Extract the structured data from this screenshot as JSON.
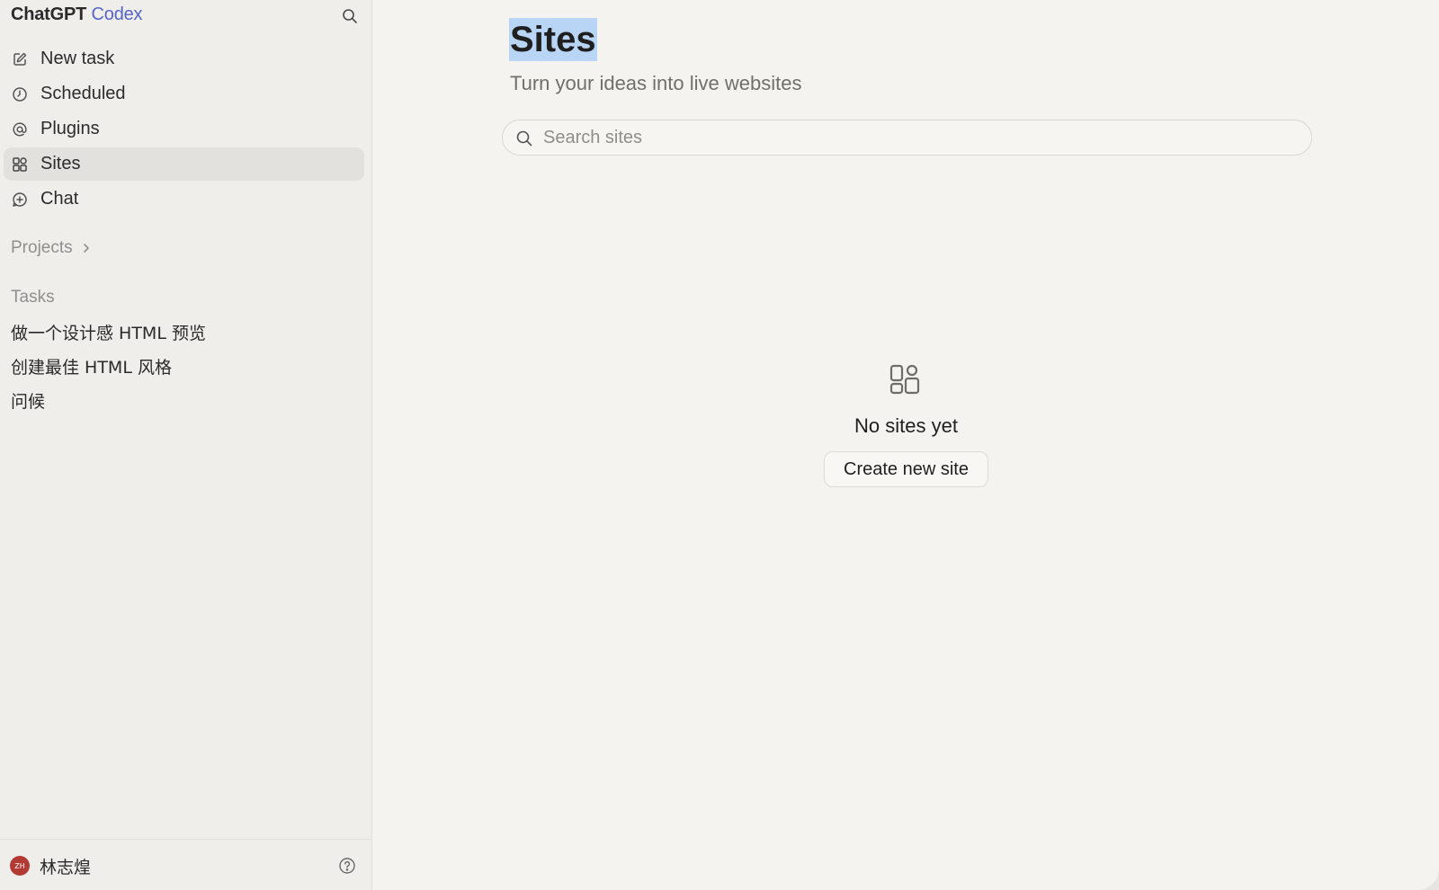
{
  "sidebar": {
    "brand": {
      "name": "ChatGPT",
      "product": "Codex"
    },
    "nav": [
      {
        "label": "New task",
        "icon": "edit-icon"
      },
      {
        "label": "Scheduled",
        "icon": "clock-icon"
      },
      {
        "label": "Plugins",
        "icon": "at-icon"
      },
      {
        "label": "Sites",
        "icon": "sites-grid-icon",
        "active": true
      },
      {
        "label": "Chat",
        "icon": "chat-plus-icon"
      }
    ],
    "projects_label": "Projects",
    "tasks_label": "Tasks",
    "tasks": [
      "做一个设计感 HTML 预览",
      "创建最佳 HTML 风格",
      "问候"
    ],
    "user": {
      "initials": "ZH",
      "name": "林志煌",
      "avatar_color": "#b23a32"
    }
  },
  "main": {
    "title": "Sites",
    "subtitle": "Turn your ideas into live websites",
    "search": {
      "placeholder": "Search sites",
      "value": ""
    },
    "empty_state": {
      "icon": "sites-grid-icon",
      "message": "No sites yet",
      "button_label": "Create new site"
    }
  },
  "colors": {
    "accent": "#5665c8",
    "background": "#f4f3ef",
    "sidebar": "#efeeeb",
    "selection": "#b9d5f5"
  }
}
